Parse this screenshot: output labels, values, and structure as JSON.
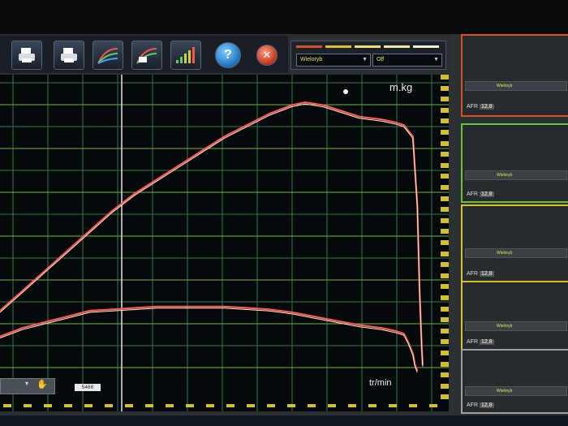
{
  "toolbar": {
    "buttons": [
      {
        "name": "print-preview-button",
        "icon": "printer-icon"
      },
      {
        "name": "print-button",
        "icon": "printer-icon"
      },
      {
        "name": "curves-button",
        "icon": "curve-chart-icon"
      },
      {
        "name": "curves-compare-button",
        "icon": "curve-chart-icon"
      },
      {
        "name": "bars-button",
        "icon": "bar-chart-icon"
      },
      {
        "name": "help-button",
        "icon": "help-icon",
        "label": "?"
      },
      {
        "name": "close-button",
        "icon": "close-icon",
        "label": "✕"
      }
    ]
  },
  "selector": {
    "legend_colors": [
      "#d8502a",
      "#d9c12a",
      "#e8e070",
      "#f0e6a0",
      "#f5f0d0"
    ],
    "left_value": "Wieloryb",
    "right_value": "Off"
  },
  "chart": {
    "y_unit": "m.kg",
    "x_unit": "tr/min",
    "rpm_value": "5468",
    "series_colors": [
      "#ff5a5a",
      "#f7e9c8"
    ]
  },
  "chart_data": {
    "type": "line",
    "xlabel": "tr/min",
    "ylabel": "m.kg",
    "series": [
      {
        "x": [
          0,
          0.05,
          0.1,
          0.15,
          0.2,
          0.25,
          0.3,
          0.35,
          0.4,
          0.45,
          0.5,
          0.55,
          0.6,
          0.65,
          0.68,
          0.72,
          0.76,
          0.8,
          0.85,
          0.88,
          0.9,
          0.92,
          0.93,
          0.935,
          0.94,
          0.942
        ],
        "values": [
          0.23,
          0.3,
          0.37,
          0.44,
          0.51,
          0.58,
          0.64,
          0.69,
          0.74,
          0.79,
          0.84,
          0.88,
          0.92,
          0.95,
          0.96,
          0.95,
          0.93,
          0.91,
          0.9,
          0.89,
          0.88,
          0.84,
          0.6,
          0.3,
          0.1,
          0.04
        ]
      },
      {
        "x": [
          0,
          0.05,
          0.1,
          0.15,
          0.2,
          0.25,
          0.3,
          0.35,
          0.4,
          0.45,
          0.5,
          0.55,
          0.6,
          0.65,
          0.7,
          0.75,
          0.8,
          0.85,
          0.88,
          0.9,
          0.91,
          0.92,
          0.925,
          0.93
        ],
        "values": [
          0.14,
          0.17,
          0.19,
          0.21,
          0.23,
          0.235,
          0.24,
          0.245,
          0.245,
          0.245,
          0.245,
          0.24,
          0.235,
          0.225,
          0.21,
          0.195,
          0.18,
          0.17,
          0.16,
          0.15,
          0.12,
          0.08,
          0.04,
          0.02
        ]
      }
    ]
  },
  "right_panel": {
    "blocks": [
      {
        "color": "#d8502a",
        "title": "Wieloryb",
        "afr_label": "AFR",
        "afr_value": "12,8"
      },
      {
        "color": "#6fbf3a",
        "title": "Wieloryb",
        "afr_label": "AFR",
        "afr_value": "12,8"
      },
      {
        "color": "#d9c12a",
        "title": "Wieloryb",
        "afr_label": "AFR",
        "afr_value": "12,8"
      },
      {
        "color": "#d9c12a",
        "title": "Wieloryb",
        "afr_label": "AFR",
        "afr_value": "12,8"
      },
      {
        "color": "#9aa0a4",
        "title": "Wieloryb",
        "afr_label": "AFR",
        "afr_value": "12,8"
      }
    ]
  }
}
